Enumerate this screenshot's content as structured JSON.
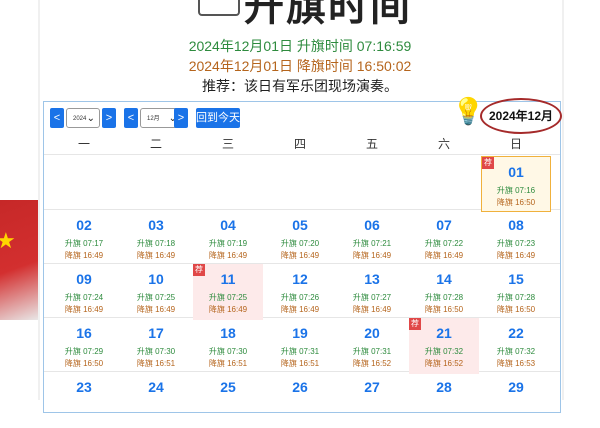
{
  "header": {
    "title": "升旗时间",
    "rise_line": "2024年12月01日 升旗时间 07:16:59",
    "set_line": "2024年12月01日 降旗时间 16:50:02",
    "note": "推荐：该日有军乐团现场演奏。"
  },
  "toolbar": {
    "prev_year": "<",
    "year_select": "2024",
    "next_year": ">",
    "prev_month": "<",
    "month_select": "12月",
    "next_month": ">",
    "today_button": "回到今天",
    "month_label": "2024年12月"
  },
  "weekdays": [
    "一",
    "二",
    "三",
    "四",
    "五",
    "六",
    "日"
  ],
  "days": [
    {
      "day": "01",
      "rise": "升旗 07:16",
      "set": "降旗 16:50",
      "col": 6,
      "row": 0,
      "state": "today",
      "badge": "荐"
    },
    {
      "day": "02",
      "rise": "升旗 07:17",
      "set": "降旗 16:49",
      "col": 0,
      "row": 1
    },
    {
      "day": "03",
      "rise": "升旗 07:18",
      "set": "降旗 16:49",
      "col": 1,
      "row": 1
    },
    {
      "day": "04",
      "rise": "升旗 07:19",
      "set": "降旗 16:49",
      "col": 2,
      "row": 1
    },
    {
      "day": "05",
      "rise": "升旗 07:20",
      "set": "降旗 16:49",
      "col": 3,
      "row": 1
    },
    {
      "day": "06",
      "rise": "升旗 07:21",
      "set": "降旗 16:49",
      "col": 4,
      "row": 1
    },
    {
      "day": "07",
      "rise": "升旗 07:22",
      "set": "降旗 16:49",
      "col": 5,
      "row": 1
    },
    {
      "day": "08",
      "rise": "升旗 07:23",
      "set": "降旗 16:49",
      "col": 6,
      "row": 1
    },
    {
      "day": "09",
      "rise": "升旗 07:24",
      "set": "降旗 16:49",
      "col": 0,
      "row": 2
    },
    {
      "day": "10",
      "rise": "升旗 07:25",
      "set": "降旗 16:49",
      "col": 1,
      "row": 2
    },
    {
      "day": "11",
      "rise": "升旗 07:25",
      "set": "降旗 16:49",
      "col": 2,
      "row": 2,
      "state": "hl",
      "badge": "荐"
    },
    {
      "day": "12",
      "rise": "升旗 07:26",
      "set": "降旗 16:49",
      "col": 3,
      "row": 2
    },
    {
      "day": "13",
      "rise": "升旗 07:27",
      "set": "降旗 16:49",
      "col": 4,
      "row": 2
    },
    {
      "day": "14",
      "rise": "升旗 07:28",
      "set": "降旗 16:50",
      "col": 5,
      "row": 2
    },
    {
      "day": "15",
      "rise": "升旗 07:28",
      "set": "降旗 16:50",
      "col": 6,
      "row": 2
    },
    {
      "day": "16",
      "rise": "升旗 07:29",
      "set": "降旗 16:50",
      "col": 0,
      "row": 3
    },
    {
      "day": "17",
      "rise": "升旗 07:30",
      "set": "降旗 16:51",
      "col": 1,
      "row": 3
    },
    {
      "day": "18",
      "rise": "升旗 07:30",
      "set": "降旗 16:51",
      "col": 2,
      "row": 3
    },
    {
      "day": "19",
      "rise": "升旗 07:31",
      "set": "降旗 16:51",
      "col": 3,
      "row": 3
    },
    {
      "day": "20",
      "rise": "升旗 07:31",
      "set": "降旗 16:52",
      "col": 4,
      "row": 3
    },
    {
      "day": "21",
      "rise": "升旗 07:32",
      "set": "降旗 16:52",
      "col": 5,
      "row": 3,
      "state": "hl",
      "badge": "荐"
    },
    {
      "day": "22",
      "rise": "升旗 07:32",
      "set": "降旗 16:53",
      "col": 6,
      "row": 3
    },
    {
      "day": "23",
      "rise": "",
      "set": "",
      "col": 0,
      "row": 4
    },
    {
      "day": "24",
      "rise": "",
      "set": "",
      "col": 1,
      "row": 4
    },
    {
      "day": "25",
      "rise": "",
      "set": "",
      "col": 2,
      "row": 4
    },
    {
      "day": "26",
      "rise": "",
      "set": "",
      "col": 3,
      "row": 4
    },
    {
      "day": "27",
      "rise": "",
      "set": "",
      "col": 4,
      "row": 4
    },
    {
      "day": "28",
      "rise": "",
      "set": "",
      "col": 5,
      "row": 4
    },
    {
      "day": "29",
      "rise": "",
      "set": "",
      "col": 6,
      "row": 4
    }
  ],
  "icons": {
    "bulb": "lightbulb-icon",
    "flag": "flag-icon",
    "banner": "banner-icon"
  }
}
